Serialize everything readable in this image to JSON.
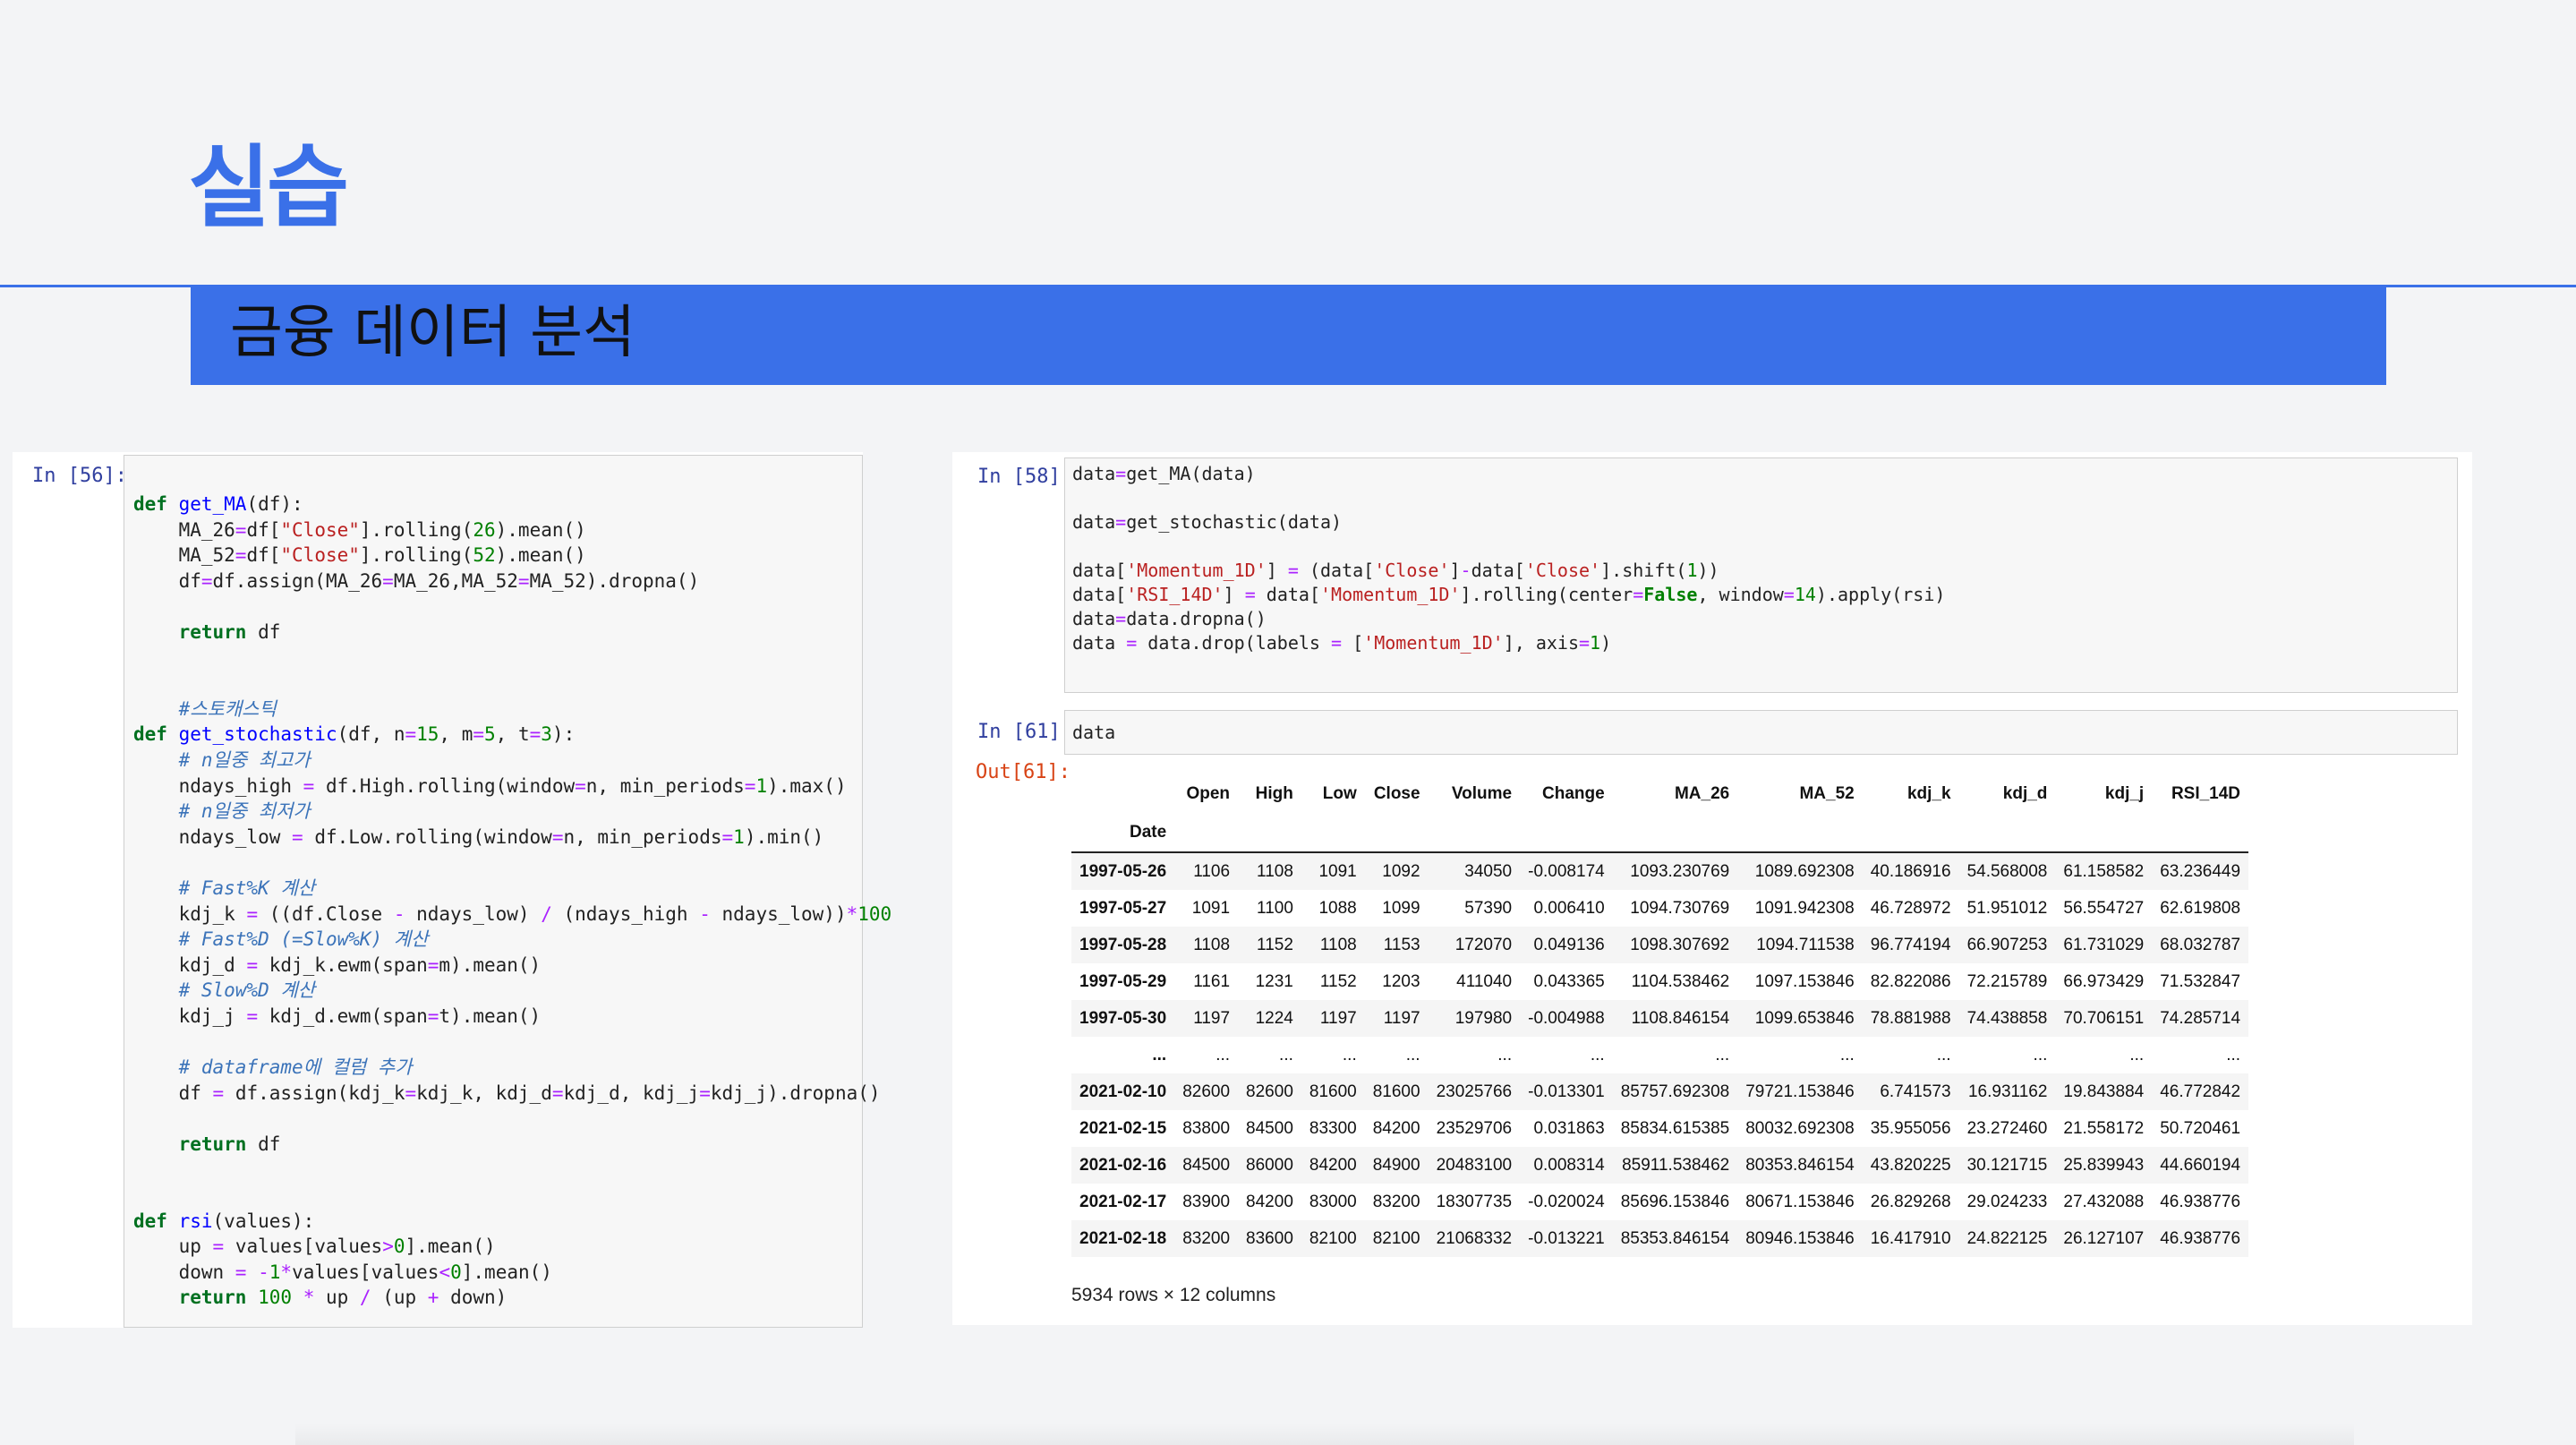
{
  "slide": {
    "title": "실습",
    "subtitle": "금융 데이터 분석"
  },
  "left_cell": {
    "prompt": "In [56]:",
    "code_lines": [
      "def get_MA(df):",
      "    MA_26=df[\"Close\"].rolling(26).mean()",
      "    MA_52=df[\"Close\"].rolling(52).mean()",
      "    df=df.assign(MA_26=MA_26,MA_52=MA_52).dropna()",
      "",
      "    return df",
      "",
      "",
      "    #스토캐스틱",
      "def get_stochastic(df, n=15, m=5, t=3):",
      "    # n일중 최고가",
      "    ndays_high = df.High.rolling(window=n, min_periods=1).max()",
      "    # n일중 최저가",
      "    ndays_low = df.Low.rolling(window=n, min_periods=1).min()",
      "",
      "    # Fast%K 계산",
      "    kdj_k = ((df.Close - ndays_low) / (ndays_high - ndays_low))*100",
      "    # Fast%D (=Slow%K) 계산",
      "    kdj_d = kdj_k.ewm(span=m).mean()",
      "    # Slow%D 계산",
      "    kdj_j = kdj_d.ewm(span=t).mean()",
      "",
      "    # dataframe에 컬럼 추가",
      "    df = df.assign(kdj_k=kdj_k, kdj_d=kdj_d, kdj_j=kdj_j).dropna()",
      "",
      "    return df",
      "",
      "",
      "def rsi(values):",
      "    up = values[values>0].mean()",
      "    down = -1*values[values<0].mean()",
      "    return 100 * up / (up + down)"
    ]
  },
  "right_cell_1": {
    "prompt": "In [58]:",
    "code_lines": [
      "data=get_MA(data)",
      "",
      "data=get_stochastic(data)",
      "",
      "data['Momentum_1D'] = (data['Close']-data['Close'].shift(1))",
      "data['RSI_14D'] = data['Momentum_1D'].rolling(center=False, window=14).apply(rsi)",
      "data=data.dropna()",
      "data = data.drop(labels = ['Momentum_1D'], axis=1)"
    ]
  },
  "right_cell_2": {
    "prompt": "In [61]:",
    "code": "data",
    "out_prompt": "Out[61]:"
  },
  "dataframe": {
    "columns": [
      "Open",
      "High",
      "Low",
      "Close",
      "Volume",
      "Change",
      "MA_26",
      "MA_52",
      "kdj_k",
      "kdj_d",
      "kdj_j",
      "RSI_14D"
    ],
    "index_name": "Date",
    "rows": [
      [
        "1997-05-26",
        "1106",
        "1108",
        "1091",
        "1092",
        "34050",
        "-0.008174",
        "1093.230769",
        "1089.692308",
        "40.186916",
        "54.568008",
        "61.158582",
        "63.236449"
      ],
      [
        "1997-05-27",
        "1091",
        "1100",
        "1088",
        "1099",
        "57390",
        "0.006410",
        "1094.730769",
        "1091.942308",
        "46.728972",
        "51.951012",
        "56.554727",
        "62.619808"
      ],
      [
        "1997-05-28",
        "1108",
        "1152",
        "1108",
        "1153",
        "172070",
        "0.049136",
        "1098.307692",
        "1094.711538",
        "96.774194",
        "66.907253",
        "61.731029",
        "68.032787"
      ],
      [
        "1997-05-29",
        "1161",
        "1231",
        "1152",
        "1203",
        "411040",
        "0.043365",
        "1104.538462",
        "1097.153846",
        "82.822086",
        "72.215789",
        "66.973429",
        "71.532847"
      ],
      [
        "1997-05-30",
        "1197",
        "1224",
        "1197",
        "1197",
        "197980",
        "-0.004988",
        "1108.846154",
        "1099.653846",
        "78.881988",
        "74.438858",
        "70.706151",
        "74.285714"
      ],
      [
        "...",
        "...",
        "...",
        "...",
        "...",
        "...",
        "...",
        "...",
        "...",
        "...",
        "...",
        "...",
        "..."
      ],
      [
        "2021-02-10",
        "82600",
        "82600",
        "81600",
        "81600",
        "23025766",
        "-0.013301",
        "85757.692308",
        "79721.153846",
        "6.741573",
        "16.931162",
        "19.843884",
        "46.772842"
      ],
      [
        "2021-02-15",
        "83800",
        "84500",
        "83300",
        "84200",
        "23529706",
        "0.031863",
        "85834.615385",
        "80032.692308",
        "35.955056",
        "23.272460",
        "21.558172",
        "50.720461"
      ],
      [
        "2021-02-16",
        "84500",
        "86000",
        "84200",
        "84900",
        "20483100",
        "0.008314",
        "85911.538462",
        "80353.846154",
        "43.820225",
        "30.121715",
        "25.839943",
        "44.660194"
      ],
      [
        "2021-02-17",
        "83900",
        "84200",
        "83000",
        "83200",
        "18307735",
        "-0.020024",
        "85696.153846",
        "80671.153846",
        "26.829268",
        "29.024233",
        "27.432088",
        "46.938776"
      ],
      [
        "2021-02-18",
        "83200",
        "83600",
        "82100",
        "82100",
        "21068332",
        "-0.013221",
        "85353.846154",
        "80946.153846",
        "16.417910",
        "24.822125",
        "26.127107",
        "46.938776"
      ]
    ],
    "shape_text": "5934 rows × 12 columns"
  }
}
